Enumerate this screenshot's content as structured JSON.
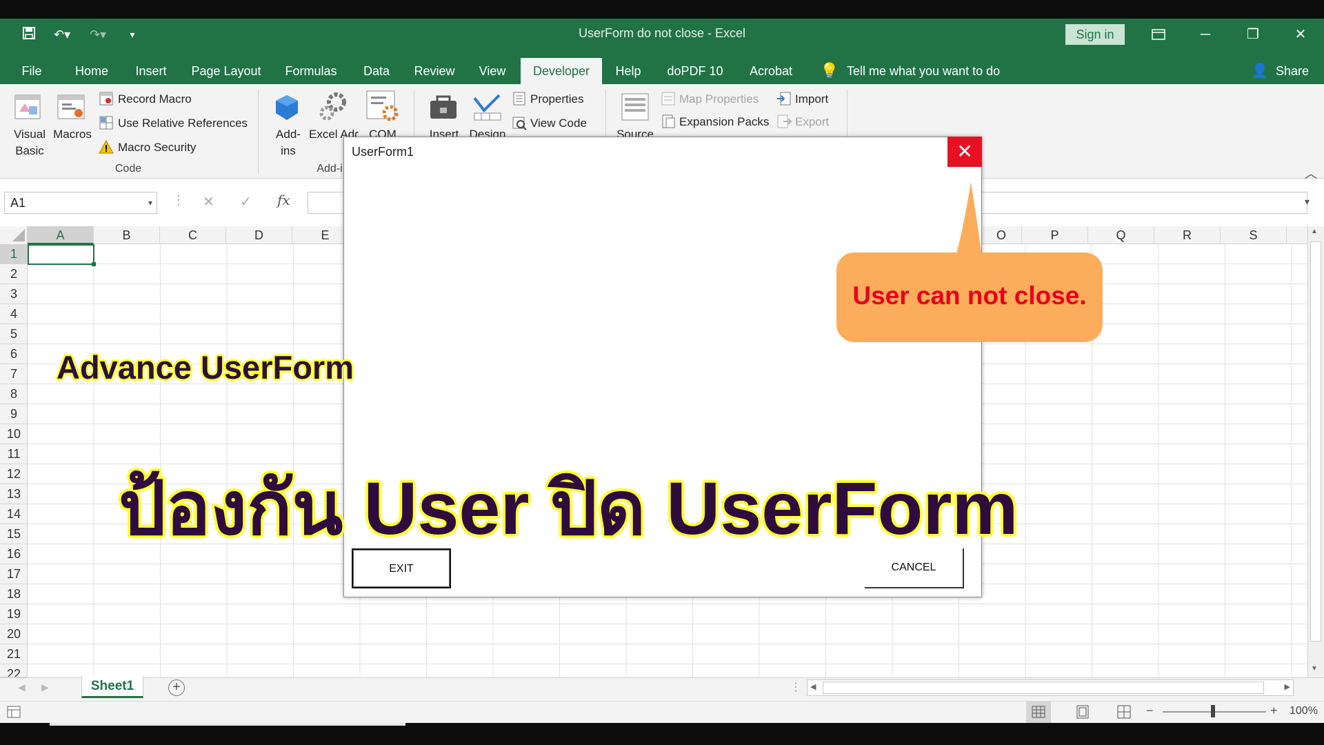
{
  "window": {
    "title": "UserForm do not close  -  Excel",
    "sign_in": "Sign in",
    "minimize": "─",
    "restore": "❐",
    "close": "✕",
    "share": "Share"
  },
  "tabs": [
    "File",
    "Home",
    "Insert",
    "Page Layout",
    "Formulas",
    "Data",
    "Review",
    "View",
    "Developer",
    "Help",
    "doPDF 10",
    "Acrobat"
  ],
  "active_tab": "Developer",
  "tell_me": "Tell me what you want to do",
  "ribbon": {
    "code": {
      "visual_basic": "Visual Basic",
      "macros": "Macros",
      "record_macro": "Record Macro",
      "use_relative": "Use Relative References",
      "macro_security": "Macro Security",
      "group_label": "Code"
    },
    "addins": {
      "addins": "Add-ins",
      "excel_addins": "Excel Add-i",
      "com": "COM",
      "group_label": "Add-i"
    },
    "controls": {
      "insert": "Insert",
      "design": "Design",
      "properties": "Properties",
      "view_code": "View Code"
    },
    "xml": {
      "source": "Source",
      "map_properties": "Map Properties",
      "expansion_packs": "Expansion Packs",
      "import": "Import",
      "export": "Export"
    }
  },
  "formula_bar": {
    "name_box": "A1",
    "fx": "fx"
  },
  "columns_left": [
    "A",
    "B",
    "C",
    "D",
    "E"
  ],
  "columns_right": [
    "O",
    "P",
    "Q",
    "R",
    "S"
  ],
  "rows": [
    "1",
    "2",
    "3",
    "4",
    "5",
    "6",
    "7",
    "8",
    "9",
    "10",
    "11",
    "12",
    "13",
    "14",
    "15",
    "16",
    "17",
    "18",
    "19",
    "20",
    "21",
    "22"
  ],
  "sheet_tab": "Sheet1",
  "zoom": "100%",
  "userform": {
    "title": "UserForm1",
    "close": "✕",
    "exit_button": "EXIT",
    "cancel_button": "CANCEL"
  },
  "callout": "User can not close.",
  "overlay": {
    "subtitle": "Advance UserForm",
    "headline": "ป้องกัน User ปิด UserForm"
  },
  "colors": {
    "excel_green": "#217346",
    "close_red": "#e81123",
    "callout_orange": "#fbad5b",
    "callout_text": "#e8001c",
    "overlay_text": "#2e0c3d",
    "overlay_outline": "#ffff33"
  }
}
